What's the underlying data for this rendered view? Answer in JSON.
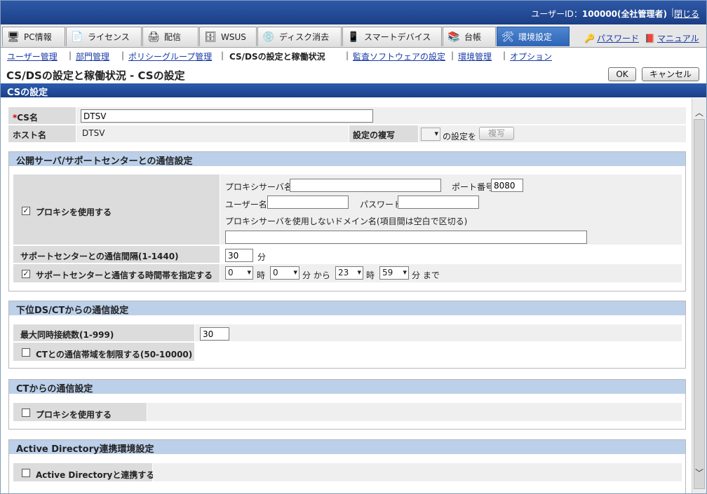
{
  "topbar": {
    "user_prefix": "ユーザーID：",
    "user_value": "100000(全社管理者)",
    "separator": "|",
    "logout": "閉じる"
  },
  "tabs": [
    {
      "label": "PC情報",
      "icon": "pc-icon"
    },
    {
      "label": "ライセンス",
      "icon": "license-icon"
    },
    {
      "label": "配信",
      "icon": "delivery-icon"
    },
    {
      "label": "WSUS",
      "icon": "wsus-icon"
    },
    {
      "label": "ディスク消去",
      "icon": "disk-erase-icon"
    },
    {
      "label": "スマートデバイス",
      "icon": "smart-device-icon"
    },
    {
      "label": "台帳",
      "icon": "ledger-icon"
    },
    {
      "label": "環境設定",
      "icon": "settings-tools-icon"
    }
  ],
  "toplinks": {
    "password": "パスワード",
    "manual": "マニュアル"
  },
  "subnav": {
    "user_mgmt": "ユーザー管理",
    "dept_mgmt": "部門管理",
    "policy_group": "ポリシーグループ管理",
    "current": "CS/DSの設定と稼働状況",
    "monitor_sw": "監査ソフトウェアの設定",
    "env_mgmt": "環境管理",
    "options": "オプション",
    "bar": "|"
  },
  "page": {
    "title": "CS/DSの設定と稼働状況 - CSの設定",
    "ok": "OK",
    "cancel": "キャンセル",
    "section_header": "CSの設定"
  },
  "cs": {
    "required_mark": "*",
    "name_label": "CS名",
    "name_value": "DTSV",
    "host_label": "ホスト名",
    "host_value": "DTSV",
    "copy_label": "設定の複写",
    "copy_suffix": "の設定を",
    "copy_button": "複写"
  },
  "public_server": {
    "title": "公開サーバ/サポートセンターとの通信設定",
    "use_proxy_label": "プロキシを使用する",
    "use_proxy_checked": true,
    "proxy_server_label": "プロキシサーバ名",
    "proxy_server_value": "",
    "port_label": "ポート番号",
    "port_value": "8080",
    "user_label": "ユーザー名",
    "user_value": "",
    "password_label": "パスワード",
    "password_value": "",
    "no_proxy_label": "プロキシサーバを使用しないドメイン名(項目間は空白で区切る)",
    "no_proxy_value": "",
    "interval_label": "サポートセンターとの通信間隔(1-1440)",
    "interval_value": "30",
    "interval_unit": "分",
    "timeband_label": "サポートセンターと通信する時間帯を指定する",
    "timeband_checked": true,
    "from_hour": "0",
    "hour_unit": "時",
    "from_min": "0",
    "from_suffix": "分 から",
    "to_hour": "23",
    "to_min": "59",
    "to_suffix": "分 まで"
  },
  "lower": {
    "title": "下位DS/CTからの通信設定",
    "max_conn_label": "最大同時接続数(1-999)",
    "max_conn_value": "30",
    "bandwidth_label": "CTとの通信帯域を制限する(50-10000)",
    "bandwidth_checked": false
  },
  "ct": {
    "title": "CTからの通信設定",
    "use_proxy_label": "プロキシを使用する",
    "use_proxy_checked": false
  },
  "ad": {
    "title": "Active Directory連携環境設定",
    "link_label": "Active Directoryと連携する",
    "link_checked": false
  },
  "colors": {
    "topbar": "#1c3f86",
    "active_tab": "#2d64b6",
    "box_header": "#bcd0ea",
    "link": "#1a3ba8"
  }
}
